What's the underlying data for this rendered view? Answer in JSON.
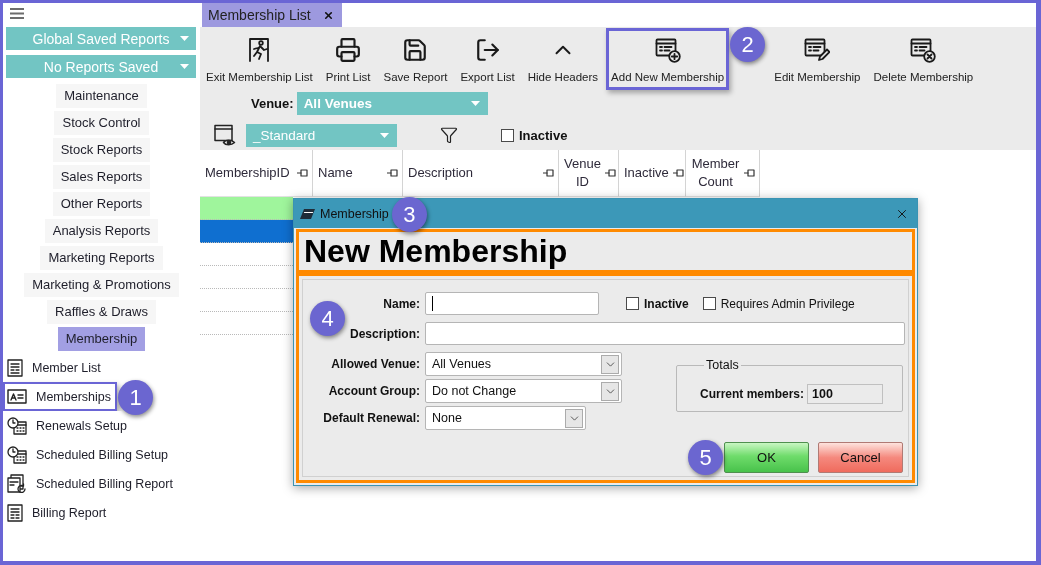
{
  "sidebar": {
    "saved_reports": [
      {
        "label": "Global Saved Reports"
      },
      {
        "label": "No Reports Saved"
      }
    ],
    "sections": [
      {
        "label": "Maintenance",
        "selected": false
      },
      {
        "label": "Stock Control",
        "selected": false
      },
      {
        "label": "Stock Reports",
        "selected": false
      },
      {
        "label": "Sales Reports",
        "selected": false
      },
      {
        "label": "Other Reports",
        "selected": false
      },
      {
        "label": "Analysis Reports",
        "selected": false
      },
      {
        "label": "Marketing Reports",
        "selected": false
      },
      {
        "label": "Marketing & Promotions",
        "selected": false
      },
      {
        "label": "Raffles & Draws",
        "selected": false
      },
      {
        "label": "Membership",
        "selected": true
      }
    ],
    "items": [
      {
        "label": "Member List",
        "highlighted": false
      },
      {
        "label": "Memberships",
        "highlighted": true,
        "callout": "1"
      },
      {
        "label": "Renewals Setup",
        "highlighted": false
      },
      {
        "label": "Scheduled Billing Setup",
        "highlighted": false
      },
      {
        "label": "Scheduled Billing Report",
        "highlighted": false
      },
      {
        "label": "Billing Report",
        "highlighted": false
      }
    ]
  },
  "tab": {
    "label": "Membership List"
  },
  "toolbar": {
    "buttons": [
      {
        "label": "Exit Membership List",
        "highlighted": false
      },
      {
        "label": "Print List",
        "highlighted": false
      },
      {
        "label": "Save Report",
        "highlighted": false
      },
      {
        "label": "Export List",
        "highlighted": false
      },
      {
        "label": "Hide Headers",
        "highlighted": false
      },
      {
        "label": "Add New Membership",
        "highlighted": true,
        "callout": "2"
      },
      {
        "label": "Edit Membership",
        "highlighted": false
      },
      {
        "label": "Delete Membership",
        "highlighted": false
      }
    ]
  },
  "filters": {
    "venue": {
      "label": "Venue:",
      "value": "All Venues"
    },
    "layout": {
      "value": "_Standard"
    },
    "inactive": {
      "label": "Inactive",
      "checked": false
    }
  },
  "table": {
    "columns": [
      "MembershipID",
      "Name",
      "Description",
      "Venue ID",
      "Inactive",
      "Member Count"
    ],
    "rows": [
      {
        "selected": false,
        "color": "#9ff59c"
      },
      {
        "selected": true
      },
      {
        "selected": false
      },
      {
        "selected": false
      },
      {
        "selected": false
      },
      {
        "selected": false
      }
    ]
  },
  "dialog": {
    "title": "Membership",
    "callout": "3",
    "heading": "New Membership",
    "highlighted": true,
    "form": {
      "callout": "4",
      "name": {
        "label": "Name:",
        "focused": true
      },
      "flags": [
        {
          "label": "Inactive",
          "checked": false
        },
        {
          "label": "Requires Admin Privilege",
          "checked": false
        }
      ],
      "description": {
        "label": "Description:",
        "focused": false
      },
      "selects": [
        {
          "label": "Allowed Venue:",
          "value": "All Venues"
        },
        {
          "label": "Account Group:",
          "value": "Do not Change"
        },
        {
          "label": "Default Renewal:",
          "value": "None"
        }
      ],
      "totals": {
        "title": "Totals",
        "label": "Current members:",
        "value": "100"
      }
    },
    "buttons": [
      {
        "kind": "ok",
        "label": "OK",
        "callout": "5"
      },
      {
        "kind": "cancel",
        "label": "Cancel"
      }
    ]
  }
}
